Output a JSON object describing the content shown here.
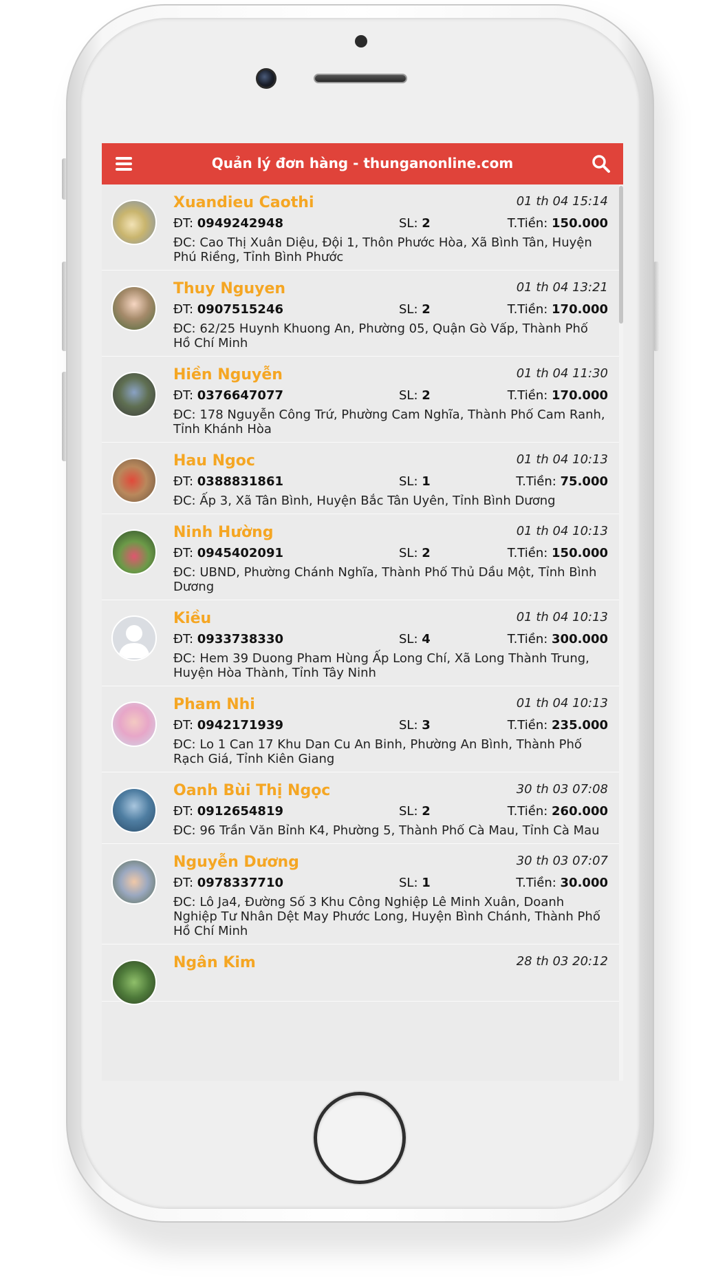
{
  "app": {
    "title": "Quản lý đơn hàng - thunganonline.com"
  },
  "labels": {
    "phone_prefix": "ĐT: ",
    "qty_prefix": "SL: ",
    "total_prefix": "T.Tiền: ",
    "address_prefix": "ĐC: "
  },
  "icons": {
    "menu": "hamburger-menu-icon",
    "search": "search-icon"
  },
  "colors": {
    "header": "#e0433a",
    "customer_name": "#f5a623",
    "row_background": "#ebebeb"
  },
  "orders": [
    {
      "name": "Xuandieu Caothi",
      "time": "01 th 04 15:14",
      "phone": "0949242948",
      "qty": "2",
      "total": "150.000",
      "address": "Cao Thị Xuân Diệu, Đội 1, Thôn Phước Hòa, Xã Bình Tân, Huyện Phú Riềng, Tỉnh Bình Phước"
    },
    {
      "name": "Thuy Nguyen",
      "time": "01 th 04 13:21",
      "phone": "0907515246",
      "qty": "2",
      "total": "170.000",
      "address": "62/25 Huynh Khuong An, Phường 05, Quận Gò Vấp, Thành Phố Hồ Chí Minh"
    },
    {
      "name": "Hiền Nguyễn",
      "time": "01 th 04 11:30",
      "phone": "0376647077",
      "qty": "2",
      "total": "170.000",
      "address": "178 Nguyễn Công Trứ, Phường Cam Nghĩa, Thành Phố Cam Ranh, Tỉnh Khánh Hòa"
    },
    {
      "name": "Hau Ngoc",
      "time": "01 th 04 10:13",
      "phone": "0388831861",
      "qty": "1",
      "total": "75.000",
      "address": "Ấp 3, Xã Tân Bình, Huyện Bắc Tân Uyên, Tỉnh Bình Dương"
    },
    {
      "name": "Ninh Hường",
      "time": "01 th 04 10:13",
      "phone": "0945402091",
      "qty": "2",
      "total": "150.000",
      "address": "UBND, Phường Chánh Nghĩa, Thành Phố Thủ Dầu Một, Tỉnh Bình Dương"
    },
    {
      "name": "Kiều",
      "time": "01 th 04 10:13",
      "phone": "0933738330",
      "qty": "4",
      "total": "300.000",
      "address": "Hem 39 Duong Pham Hùng Ấp Long Chí, Xã Long Thành Trung, Huyện Hòa Thành, Tỉnh Tây Ninh"
    },
    {
      "name": "Pham Nhi",
      "time": "01 th 04 10:13",
      "phone": "0942171939",
      "qty": "3",
      "total": "235.000",
      "address": "Lo 1 Can 17 Khu Dan Cu An Binh, Phường An Bình, Thành Phố Rạch Giá, Tỉnh Kiên Giang"
    },
    {
      "name": "Oanh Bùi Thị Ngọc",
      "time": "30 th 03 07:08",
      "phone": "0912654819",
      "qty": "2",
      "total": "260.000",
      "address": "96 Trần Văn Bỉnh K4, Phường 5, Thành Phố Cà Mau, Tỉnh Cà Mau"
    },
    {
      "name": "Nguyễn Dương",
      "time": "30 th 03 07:07",
      "phone": "0978337710",
      "qty": "1",
      "total": "30.000",
      "address": "Lô Ja4, Đường Số 3 Khu Công Nghiệp Lê Minh Xuân, Doanh Nghiệp Tư Nhân Dệt May Phước Long, Huyện Bình Chánh, Thành Phố Hồ Chí Minh"
    },
    {
      "name": "Ngân Kim",
      "time": "28 th 03 20:12",
      "phone": "",
      "qty": "",
      "total": "",
      "address": ""
    }
  ]
}
